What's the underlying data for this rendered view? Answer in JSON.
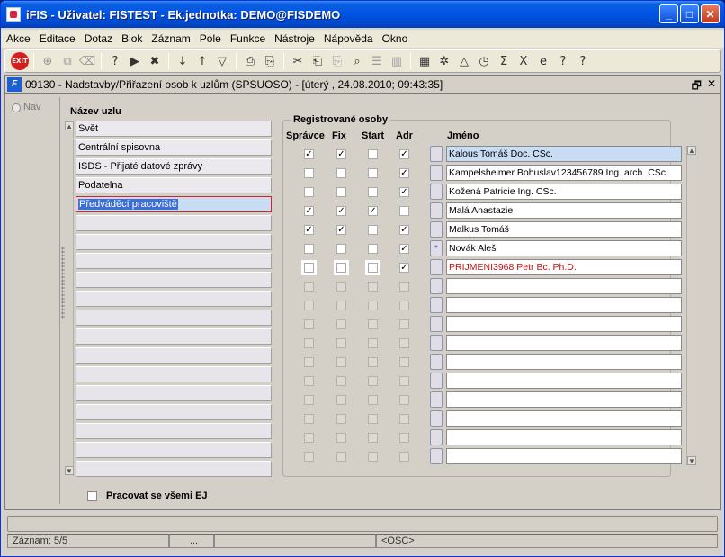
{
  "window": {
    "title": "iFIS - Uživatel: FISTEST - Ek.jednotka: DEMO@FISDEMO",
    "controls": {
      "minimize": "_",
      "maximize": "□",
      "close": "✕"
    }
  },
  "menu": [
    "Akce",
    "Editace",
    "Dotaz",
    "Blok",
    "Záznam",
    "Pole",
    "Funkce",
    "Nástroje",
    "Nápověda",
    "Okno"
  ],
  "toolbar": {
    "exit_label": "EXIT"
  },
  "form": {
    "title": "09130 - Nadstavby/Přiřazení osob k uzlům (SPSUOSO) - [úterý  , 24.08.2010; 09:43:35]",
    "icon_letter": "F",
    "restore": "🗗",
    "close": "✕",
    "nav_label": "Nav"
  },
  "nodes": {
    "heading": "Název uzlu",
    "items": [
      "Svět",
      "Centrální spisovna",
      "ISDS - Přijaté datové zprávy",
      "Podatelna",
      "Předváděcí pracoviště"
    ],
    "active_index": 4
  },
  "registered": {
    "title": "Registrované osoby",
    "headers": {
      "spravce": "Správce",
      "fix": "Fix",
      "start": "Start",
      "adr": "Adr",
      "jmeno": "Jméno"
    },
    "rows": [
      {
        "spravce": true,
        "fix": true,
        "start": false,
        "adr": true,
        "name": "Kalous Tomáš Doc. CSc.",
        "mark": ""
      },
      {
        "spravce": false,
        "fix": false,
        "start": false,
        "adr": true,
        "name": "Kampelsheimer Bohuslav123456789 Ing. arch. CSc.",
        "mark": ""
      },
      {
        "spravce": false,
        "fix": false,
        "start": false,
        "adr": true,
        "name": "Kožená Patricie Ing. CSc.",
        "mark": ""
      },
      {
        "spravce": true,
        "fix": true,
        "start": true,
        "adr": false,
        "name": "Malá Anastazie",
        "mark": ""
      },
      {
        "spravce": true,
        "fix": true,
        "start": false,
        "adr": true,
        "name": "Malkus Tomáš",
        "mark": ""
      },
      {
        "spravce": false,
        "fix": false,
        "start": false,
        "adr": true,
        "name": "Novák Aleš",
        "mark": "*"
      },
      {
        "spravce": false,
        "fix": false,
        "start": false,
        "adr": true,
        "name": "PRIJMENI3968 Petr  Bc. Ph.D.",
        "mark": ""
      }
    ]
  },
  "footer": {
    "all_ej_label": "Pracovat se všemi EJ"
  },
  "status": {
    "record": "Záznam: 5/5",
    "dots": "...",
    "osc": "<OSC>"
  }
}
